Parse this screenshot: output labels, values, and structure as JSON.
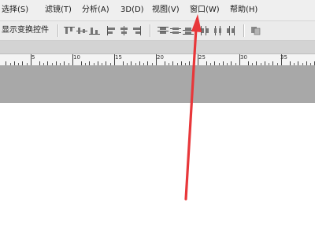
{
  "menu": {
    "items": [
      {
        "label": "选择(S)"
      },
      {
        "label": "滤镜(T)"
      },
      {
        "label": "分析(A)"
      },
      {
        "label": "3D(D)"
      },
      {
        "label": "视图(V)"
      },
      {
        "label": "窗口(W)"
      },
      {
        "label": "帮助(H)"
      }
    ]
  },
  "options": {
    "show_transform_controls": "显示变换控件",
    "icons": [
      "align-top-edges-icon",
      "align-vertical-centers-icon",
      "align-bottom-edges-icon",
      "align-left-edges-icon",
      "align-horizontal-centers-icon",
      "align-right-edges-icon",
      "distribute-top-edges-icon",
      "distribute-vertical-centers-icon",
      "distribute-bottom-edges-icon",
      "distribute-left-edges-icon",
      "distribute-horizontal-centers-icon",
      "distribute-right-edges-icon",
      "auto-align-layers-icon"
    ]
  },
  "ruler": {
    "labels": [
      "5",
      "10",
      "15",
      "20",
      "25",
      "30",
      "35"
    ]
  },
  "annotation": {
    "arrow_color": "#e8373a"
  }
}
